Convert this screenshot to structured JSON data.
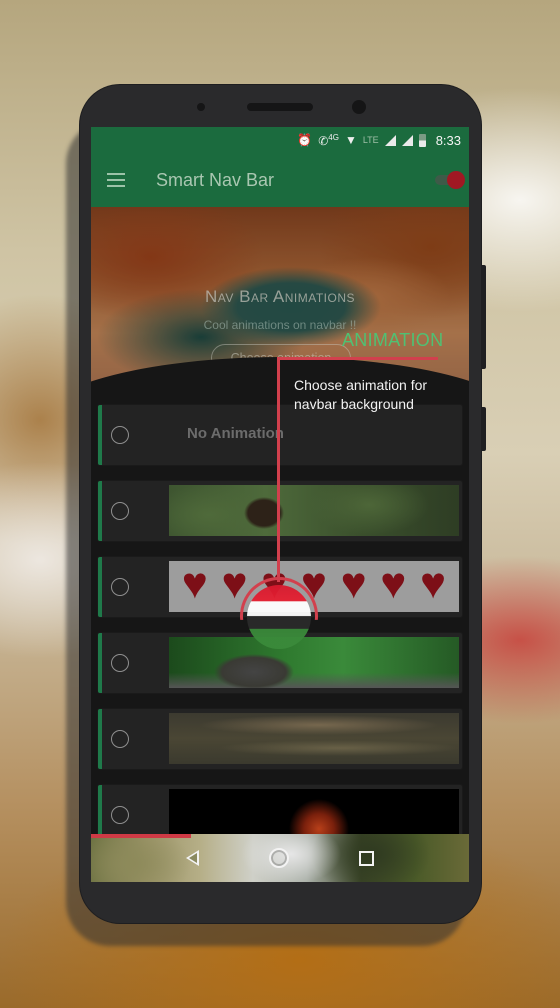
{
  "status_bar": {
    "icons": [
      "alarm-icon",
      "volte-call-icon",
      "4g-label",
      "wifi-icon",
      "lte-label",
      "signal-icon",
      "signal-icon",
      "battery-icon"
    ],
    "volte_label": "4G",
    "lte_label": "LTE",
    "time": "8:33"
  },
  "toolbar": {
    "menu_icon": "hamburger-icon",
    "title": "Smart Nav Bar",
    "toggle_on": true
  },
  "hero": {
    "title": "Nav Bar Animations",
    "subtitle": "Cool animations on navbar !!",
    "button_label": "Choose animation"
  },
  "list": {
    "items": [
      {
        "label": "No Animation",
        "selected": false,
        "thumbnail": "none"
      },
      {
        "label": "",
        "selected": false,
        "thumbnail": "bird"
      },
      {
        "label": "",
        "selected": false,
        "thumbnail": "hearts"
      },
      {
        "label": "",
        "selected": false,
        "thumbnail": "frog"
      },
      {
        "label": "",
        "selected": false,
        "thumbnail": "clouds"
      },
      {
        "label": "",
        "selected": false,
        "thumbnail": "fire"
      }
    ]
  },
  "tutorial": {
    "title": "ANIMATION",
    "description": "Choose animation for navbar background"
  },
  "navbar": {
    "buttons": [
      "back-icon",
      "home-icon",
      "recents-icon"
    ]
  },
  "colors": {
    "primary": "#1b6b3e",
    "accent": "#a01823",
    "highlight": "#d2404d",
    "tutorial_title": "#4fc173"
  }
}
